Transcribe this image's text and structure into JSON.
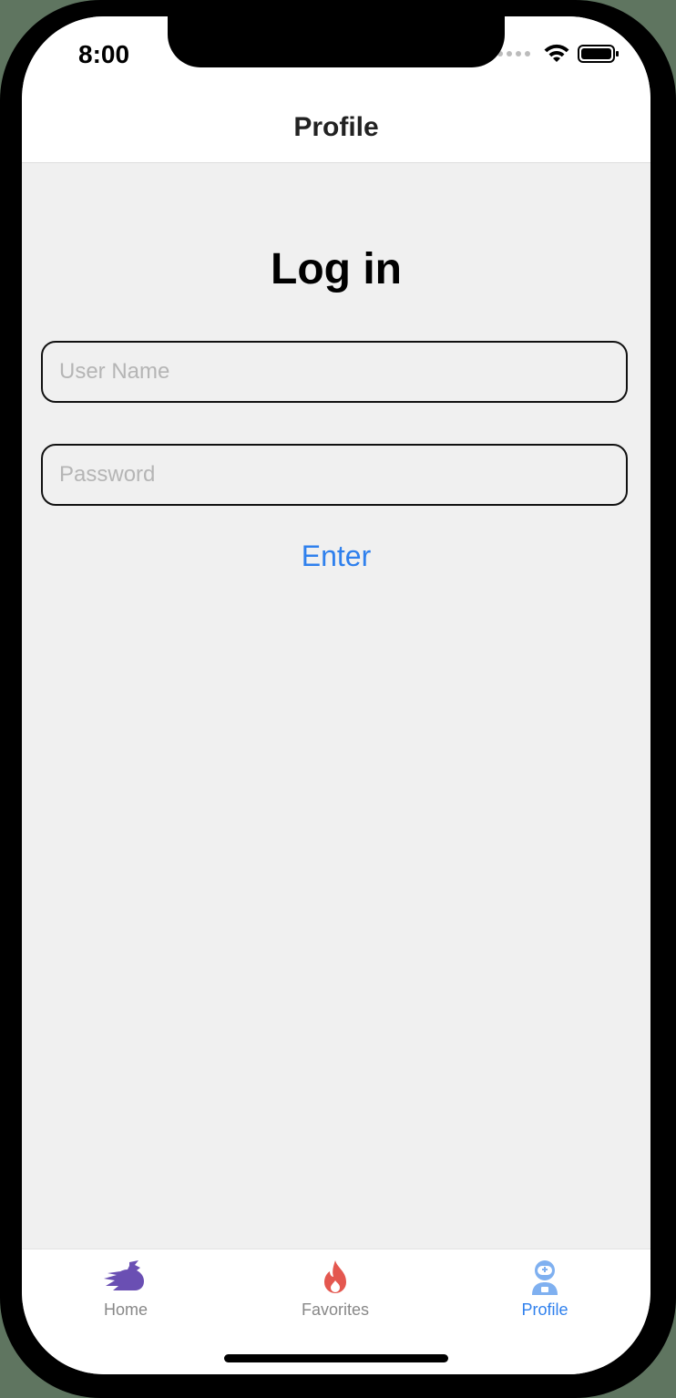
{
  "status": {
    "time": "8:00"
  },
  "nav": {
    "title": "Profile"
  },
  "login": {
    "heading": "Log in",
    "username_placeholder": "User Name",
    "username_value": "",
    "password_placeholder": "Password",
    "password_value": "",
    "enter_label": "Enter"
  },
  "tabs": [
    {
      "label": "Home",
      "icon": "dragon-icon",
      "active": false,
      "color": "#888888",
      "icon_color": "#6a4fb3"
    },
    {
      "label": "Favorites",
      "icon": "fire-icon",
      "active": false,
      "color": "#888888",
      "icon_color": "#e4574f"
    },
    {
      "label": "Profile",
      "icon": "astronaut-icon",
      "active": true,
      "color": "#2f80ed",
      "icon_color": "#7fb0f0"
    }
  ],
  "colors": {
    "accent": "#2f80ed",
    "background": "#f0f0f0"
  }
}
